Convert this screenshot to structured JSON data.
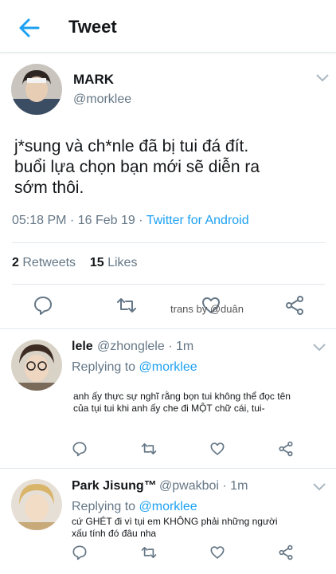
{
  "header": {
    "title": "Tweet"
  },
  "tweet": {
    "name": "MARK",
    "handle": "@morklee",
    "text_line1": "j*sung và ch*nle đã bị tui đá đít.",
    "text_line2": "buổi lựa chọn bạn mới sẽ diễn ra",
    "text_line3": "sớm thôi.",
    "timestamp": "05:18 PM · 16 Feb 19 ·",
    "source": "Twitter for Android",
    "retweets_count": "2",
    "retweets_label": "Retweets",
    "likes_count": "15",
    "likes_label": "Likes",
    "watermark": "trans by @duân"
  },
  "replies": [
    {
      "name": "lele",
      "handle": "@zhonglele · 1m",
      "replying_prefix": "Replying to",
      "replying_mention": "@morklee",
      "text_line1": "anh ấy thực sự nghĩ rằng bọn tui không thể đọc tên",
      "text_line2": "của tụi tui khi anh ấy che đi MỘT chữ cái, tui-"
    },
    {
      "name": "Park Jisung™",
      "handle": "@pwakboi · 1m",
      "replying_prefix": "Replying to",
      "replying_mention": "@morklee",
      "text_line1": "cứ GHÉT đi vì tụi em KHÔNG phải những người",
      "text_line2": "xấu tính đó đâu nha"
    }
  ],
  "colors": {
    "accent": "#1da1f2",
    "secondary_text": "#657786",
    "divider": "#e1e8ed"
  }
}
